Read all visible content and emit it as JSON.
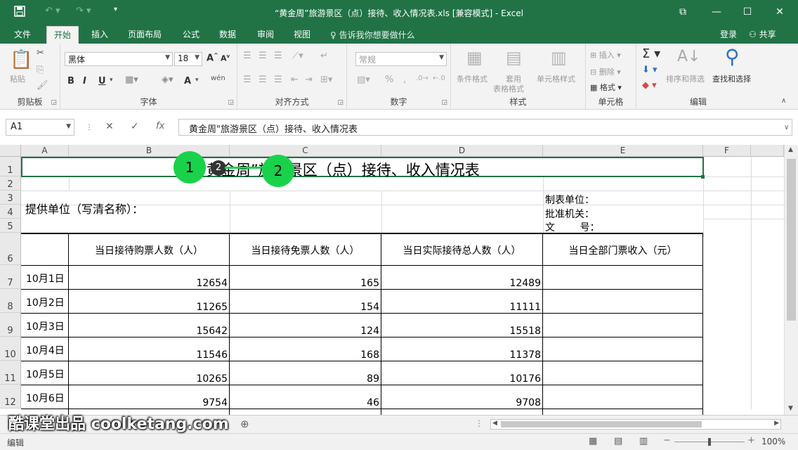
{
  "window": {
    "title": "“黄金周”旅游景区（点）接待、收入情况表.xls  [兼容模式] - Excel",
    "save_icon": "save-icon",
    "undo_icon": "undo-icon",
    "redo_icon": "redo-icon"
  },
  "tabs": [
    "文件",
    "开始",
    "插入",
    "页面布局",
    "公式",
    "数据",
    "审阅",
    "视图"
  ],
  "active_tab": "开始",
  "tell_me": "告诉我你想要做什么",
  "login": "登录",
  "share": "共享",
  "ribbon": {
    "clipboard": {
      "paste": "粘贴",
      "label": "剪贴板"
    },
    "font": {
      "name": "黑体",
      "size": "18",
      "label": "字体",
      "bold": "B",
      "italic": "I",
      "underline": "U",
      "wen": "wén",
      "A": "A"
    },
    "alignment": {
      "label": "对齐方式"
    },
    "number": {
      "format": "常规",
      "label": "数字",
      "percent": "%",
      "comma": ","
    },
    "styles": {
      "conditional": "条件格式",
      "table_format_1": "套用",
      "table_format_2": "表格格式",
      "cell_styles": "单元格样式",
      "label": "样式"
    },
    "cells": {
      "insert": "插入",
      "delete": "删除",
      "format": "格式",
      "label": "单元格"
    },
    "editing": {
      "sort_filter": "排序和筛选",
      "find_select": "查找和选择",
      "label": "编辑"
    }
  },
  "formula_bar": {
    "name_box": "A1",
    "fx": "fx",
    "content": "黄金周\"旅游景区（点）接待、收入情况表"
  },
  "columns": [
    "A",
    "B",
    "C",
    "D",
    "E",
    "F"
  ],
  "rows": [
    "1",
    "2",
    "3",
    "4",
    "5",
    "6",
    "7",
    "8",
    "9",
    "10",
    "11",
    "12"
  ],
  "sheet": {
    "title": "“黄金周”旅游景区（点）接待、收入情况表",
    "provider": "提供单位（写清名称）：",
    "maker": "制表单位：",
    "approver": "批准机关：",
    "doc_no": "文        号：",
    "headers": [
      "当日接待购票人数（人）",
      "当日接待免票人数（人）",
      "当日实际接待总人数（人）",
      "当日全部门票收入（元）"
    ],
    "data": [
      {
        "date": "10月1日",
        "paid": "12654",
        "free": "165",
        "total": "12489"
      },
      {
        "date": "10月2日",
        "paid": "11265",
        "free": "154",
        "total": "11111"
      },
      {
        "date": "10月3日",
        "paid": "15642",
        "free": "124",
        "total": "15518"
      },
      {
        "date": "10月4日",
        "paid": "11546",
        "free": "168",
        "total": "11378"
      },
      {
        "date": "10月5日",
        "paid": "10265",
        "free": "89",
        "total": "10176"
      },
      {
        "date": "10月6日",
        "paid": "9754",
        "free": "46",
        "total": "9708"
      }
    ]
  },
  "annotations": [
    "1",
    "2",
    "2"
  ],
  "status": {
    "mode": "编辑",
    "zoom": "100%"
  },
  "watermark": "酷课堂出品 coolketang.com",
  "colors": {
    "excel_green": "#217346",
    "marker_green": "#19d24a"
  }
}
